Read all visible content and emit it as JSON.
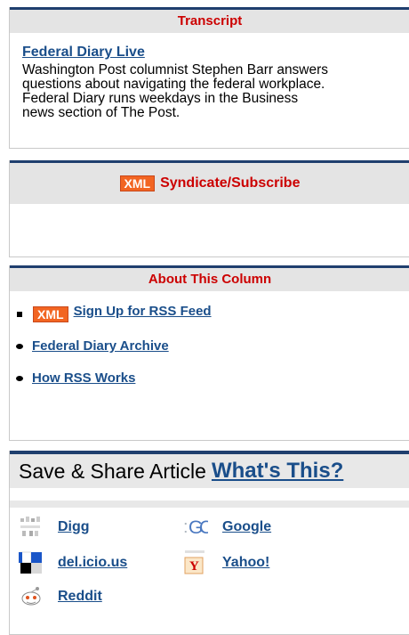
{
  "transcript": {
    "header": "Transcript",
    "title": "Federal Diary Live",
    "desc_lines": [
      "Washington Post columnist Stephen Barr answers",
      "questions about navigating the federal workplace.",
      "Federal Diary runs weekdays in the Business",
      "news section of The Post."
    ]
  },
  "syndicate": {
    "badge": "XML",
    "label": "Syndicate/Subscribe"
  },
  "about": {
    "header": "About This Column",
    "items": [
      {
        "label": "Sign Up for RSS Feed",
        "badge": "XML"
      },
      {
        "label": "Federal Diary Archive"
      },
      {
        "label": "How RSS Works"
      }
    ]
  },
  "share": {
    "title": "Save & Share Article",
    "whats_this": "What's This?",
    "items": [
      {
        "label": "Digg",
        "icon": "digg-icon"
      },
      {
        "label": "Google",
        "icon": "google-icon"
      },
      {
        "label": "del.icio.us",
        "icon": "delicious-icon"
      },
      {
        "label": "Yahoo!",
        "icon": "yahoo-icon"
      },
      {
        "label": "Reddit",
        "icon": "reddit-icon"
      }
    ]
  }
}
